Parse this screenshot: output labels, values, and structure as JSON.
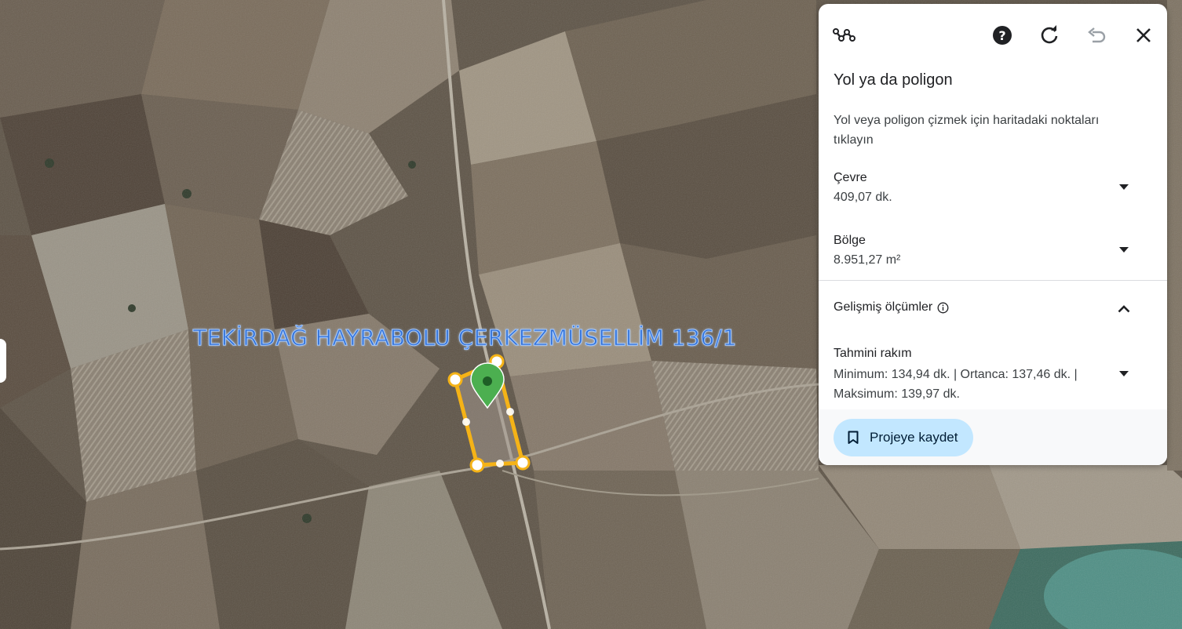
{
  "map": {
    "place_label": "TEKİRDAĞ HAYRABOLU ÇERKEZMÜSELLİM 136/1"
  },
  "panel": {
    "toolbar": {
      "measure_icon": "path-measure-icon",
      "help_icon": "help-icon",
      "refresh_icon": "refresh-icon",
      "undo_icon": "undo-icon",
      "close_icon": "close-icon"
    },
    "title": "Yol ya da poligon",
    "description": "Yol veya poligon çizmek için haritadaki noktaları tıklayın",
    "perimeter": {
      "label": "Çevre",
      "value": "409,07 dk."
    },
    "area": {
      "label": "Bölge",
      "value": "8.951,27 m²"
    },
    "advanced": {
      "label": "Gelişmiş ölçümler"
    },
    "elevation": {
      "label": "Tahmini rakım",
      "values": "Minimum: 134,94 dk. | Ortanca: 137,46 dk. | Maksimum: 139,97 dk."
    },
    "save_button": "Projeye kaydet"
  },
  "colors": {
    "polygon": "#f5b317",
    "pin": "#4caf50",
    "button_bg": "#c2e7ff",
    "label_blue": "#2f6fd6"
  }
}
